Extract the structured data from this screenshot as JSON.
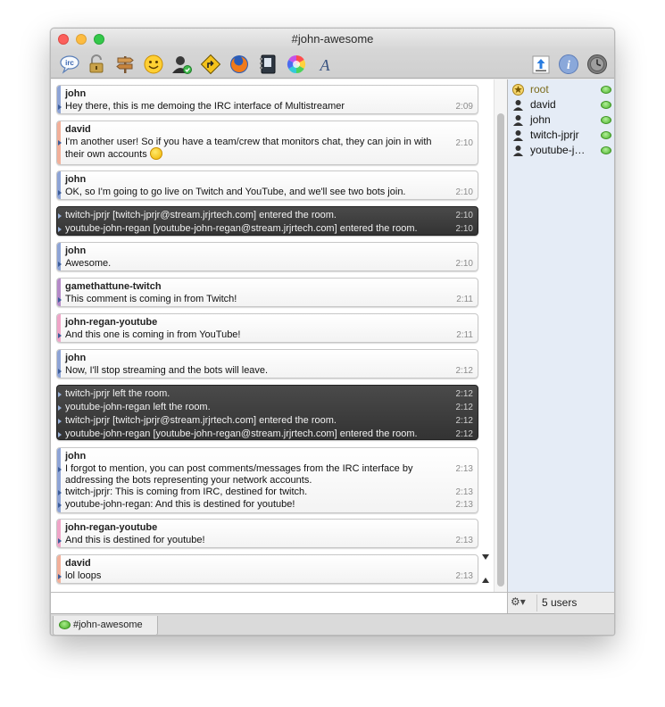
{
  "window": {
    "title": "#john-awesome"
  },
  "toolbar": {
    "items": [
      {
        "name": "irc-icon",
        "glyph": "irc"
      },
      {
        "name": "lock-icon"
      },
      {
        "name": "signpost-icon"
      },
      {
        "name": "smiley-icon"
      },
      {
        "name": "user-check-icon"
      },
      {
        "name": "route-sign-icon"
      },
      {
        "name": "firefox-icon"
      },
      {
        "name": "notebook-icon"
      },
      {
        "name": "color-wheel-icon"
      },
      {
        "name": "font-icon",
        "glyph": "A"
      }
    ],
    "right": [
      {
        "name": "share-icon"
      },
      {
        "name": "info-icon",
        "glyph": "i"
      },
      {
        "name": "clock-icon"
      }
    ]
  },
  "messages": [
    {
      "kind": "msg",
      "nick": "john",
      "color": "#8ea4d6",
      "lines": [
        {
          "text": "Hey there, this is me demoing the IRC interface of Multistreamer",
          "time": "2:09"
        }
      ]
    },
    {
      "kind": "msg",
      "nick": "david",
      "color": "#f2b09a",
      "lines": [
        {
          "text": "I'm another user! So if you have a team/crew that monitors chat, they can join in with their own accounts",
          "time": "2:10"
        }
      ]
    },
    {
      "kind": "msg",
      "nick": "john",
      "color": "#8ea4d6",
      "lines": [
        {
          "text": "OK, so I'm going to go live on Twitch and YouTube, and we'll see two bots join.",
          "time": "2:10"
        }
      ]
    },
    {
      "kind": "event",
      "lines": [
        {
          "text": "twitch-jprjr [twitch-jprjr@stream.jrjrtech.com] entered the room.",
          "time": "2:10"
        },
        {
          "text": "youtube-john-regan [youtube-john-regan@stream.jrjrtech.com] entered the room.",
          "time": "2:10"
        }
      ]
    },
    {
      "kind": "msg",
      "nick": "john",
      "color": "#8ea4d6",
      "lines": [
        {
          "text": "Awesome.",
          "time": "2:10"
        }
      ]
    },
    {
      "kind": "msg",
      "nick": "gamethattune-twitch",
      "color": "#b48ac8",
      "lines": [
        {
          "text": "This comment is coming in from Twitch!",
          "time": "2:11"
        }
      ]
    },
    {
      "kind": "msg",
      "nick": "john-regan-youtube",
      "color": "#f0a5c8",
      "lines": [
        {
          "text": "And this one is coming in from YouTube!",
          "time": "2:11"
        }
      ]
    },
    {
      "kind": "msg",
      "nick": "john",
      "color": "#8ea4d6",
      "lines": [
        {
          "text": "Now, I'll stop streaming and the bots will leave.",
          "time": "2:12"
        }
      ]
    },
    {
      "kind": "event",
      "lines": [
        {
          "text": "twitch-jprjr left the room.",
          "time": "2:12"
        },
        {
          "text": "youtube-john-regan left the room.",
          "time": "2:12"
        },
        {
          "text": "twitch-jprjr [twitch-jprjr@stream.jrjrtech.com] entered the room.",
          "time": "2:12"
        },
        {
          "text": "youtube-john-regan [youtube-john-regan@stream.jrjrtech.com] entered the room.",
          "time": "2:12"
        }
      ]
    },
    {
      "kind": "msg",
      "nick": "john",
      "color": "#8ea4d6",
      "lines": [
        {
          "text": "I forgot to mention, you can post comments/messages from the IRC interface by addressing the bots representing your network accounts.",
          "time": "2:13"
        },
        {
          "text": "twitch-jprjr: This is coming from IRC, destined for twitch.",
          "time": "2:13"
        },
        {
          "text": "youtube-john-regan: And this is destined for youtube!",
          "time": "2:13"
        }
      ]
    },
    {
      "kind": "msg",
      "nick": "john-regan-youtube",
      "color": "#f0a5c8",
      "lines": [
        {
          "text": "And this is destined for youtube!",
          "time": "2:13"
        }
      ]
    },
    {
      "kind": "msg",
      "nick": "david",
      "color": "#f2b09a",
      "lines": [
        {
          "text": "lol loops",
          "time": "2:13"
        }
      ]
    }
  ],
  "users": [
    {
      "name": "root",
      "role": "operator",
      "color": "#7a6a1a"
    },
    {
      "name": "david",
      "role": "member"
    },
    {
      "name": "john",
      "role": "member"
    },
    {
      "name": "twitch-jprjr",
      "role": "member"
    },
    {
      "name": "youtube-j…",
      "role": "member"
    }
  ],
  "sidebar": {
    "user_count": "5 users",
    "gear_label": "⚙▾"
  },
  "tabs": [
    {
      "label": "#john-awesome"
    }
  ]
}
